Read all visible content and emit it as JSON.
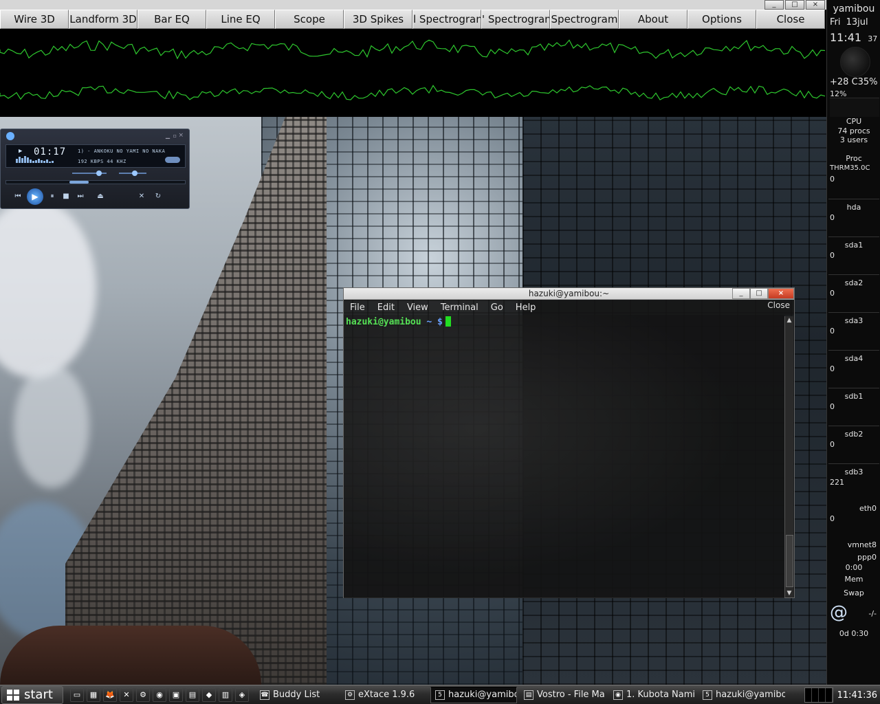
{
  "visualizer": {
    "tabs": [
      "Wire 3D",
      "Landform 3D",
      "Bar EQ",
      "Line EQ",
      "Scope",
      "3D Spikes",
      "Horiz Spectrogram",
      "Vert Spectrogram",
      "Spectrogram",
      "About",
      "Options",
      "Close"
    ],
    "tab_display": [
      "Wire 3D",
      "Landform 3D",
      "Bar EQ",
      "Line EQ",
      "Scope",
      "3D Spikes",
      "l Spectrogran",
      "' Spectrogran",
      "Spectrogram",
      "About",
      "Options",
      "Close"
    ],
    "wm_buttons": [
      "_",
      "□",
      "×"
    ],
    "scope_color": "#2ec82e"
  },
  "gkrellm": {
    "hostname": "yamibou",
    "day": "Fri",
    "date": "13jul",
    "time": "11:41",
    "seconds": "37",
    "temp_line": "+28 C35%",
    "cpu_pct": "12%",
    "cpu_label": "CPU",
    "procs": "74 procs",
    "users": "3 users",
    "proc_label": "Proc",
    "thrm": "THRM35.0C",
    "disks": [
      {
        "label": "hda",
        "value": "0"
      },
      {
        "label": "sda1",
        "value": "0"
      },
      {
        "label": "sda2",
        "value": "0"
      },
      {
        "label": "sda3",
        "value": "0"
      },
      {
        "label": "sda4",
        "value": "0"
      },
      {
        "label": "sdb1",
        "value": "0"
      },
      {
        "label": "sdb2",
        "value": "0"
      },
      {
        "label": "sdb3",
        "value": "221"
      }
    ],
    "top_value": "0",
    "eth0": "eth0",
    "eth0_value": "0",
    "vmnet8": "vmnet8",
    "ppp0": "ppp0",
    "ppp0_time": "0:00",
    "mem": "Mem",
    "swap": "Swap",
    "mail": "-/-",
    "uptime": "0d  0:30"
  },
  "player": {
    "time": "01:17",
    "track": "1) - ANKOKU NO YAMI NO NAKA",
    "rate": "192 KBPS  44 KHZ",
    "controls": [
      "⏮",
      "▶",
      "⏸",
      "■",
      "⏭",
      "⏏"
    ]
  },
  "terminal": {
    "title": "hazuki@yamibou:~",
    "menus": [
      "File",
      "Edit",
      "View",
      "Terminal",
      "Go",
      "Help"
    ],
    "close_hint": "Close",
    "prompt_user": "hazuki@yamibou",
    "prompt_tail": "~ $",
    "buttons": [
      "_",
      "□",
      "×"
    ]
  },
  "taskbar": {
    "start_label": "start",
    "quick_icons": [
      "▭",
      "▦",
      "🦊",
      "✕",
      "⚙",
      "◉",
      "▣",
      "▤",
      "◆",
      "▥",
      "◈"
    ],
    "tasks": [
      {
        "icon": "☎",
        "label": "Buddy List",
        "pressed": false
      },
      {
        "icon": "⚙",
        "label": "eXtace 1.9.6",
        "pressed": false
      },
      {
        "icon": "5",
        "label": "hazuki@yamibo",
        "pressed": true
      },
      {
        "icon": "▤",
        "label": "Vostro - File Ma",
        "pressed": false
      },
      {
        "icon": "◉",
        "label": "1. Kubota Nami",
        "pressed": false
      },
      {
        "icon": "5",
        "label": "hazuki@yamibo",
        "pressed": false
      }
    ],
    "clock": "11:41:36"
  }
}
